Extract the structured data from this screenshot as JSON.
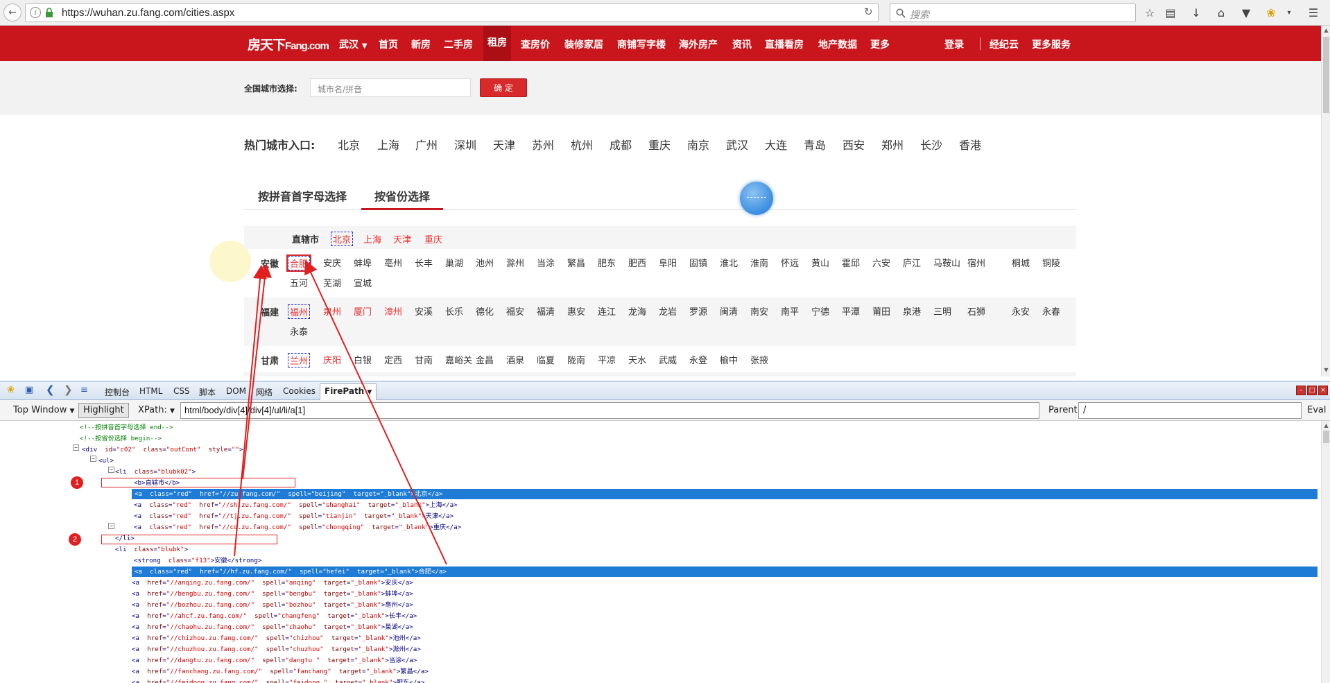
{
  "browser": {
    "url": "https://wuhan.zu.fang.com/cities.aspx",
    "search_placeholder": "搜索"
  },
  "site": {
    "logo_main": "房天下",
    "logo_sub": "Fang.com",
    "city_selector": "武汉",
    "nav": [
      "首页",
      "新房",
      "二手房",
      "租房",
      "查房价",
      "装修家居",
      "商铺写字楼",
      "海外房产",
      "资讯",
      "直播看房",
      "地产数据",
      "更多"
    ],
    "active_nav": "租房",
    "login": "登录",
    "agent": "经纪云",
    "more_services": "更多服务"
  },
  "city_search": {
    "label": "全国城市选择:",
    "placeholder": "城市名/拼音",
    "button": "确 定"
  },
  "hot": {
    "label": "热门城市入口:",
    "cities": [
      "北京",
      "上海",
      "广州",
      "深圳",
      "天津",
      "苏州",
      "杭州",
      "成都",
      "重庆",
      "南京",
      "武汉",
      "大连",
      "青岛",
      "西安",
      "郑州",
      "长沙",
      "香港"
    ]
  },
  "tabs": [
    "按拼音首字母选择",
    "按省份选择"
  ],
  "provinces": {
    "direct": {
      "name": "直辖市",
      "cities": [
        "北京",
        "上海",
        "天津",
        "重庆"
      ]
    },
    "anhui": {
      "name": "安徽",
      "line1": [
        "合肥",
        "安庆",
        "蚌埠",
        "亳州",
        "长丰",
        "巢湖",
        "池州",
        "滁州",
        "当涂",
        "繁昌",
        "肥东",
        "肥西",
        "阜阳",
        "固镇",
        "淮北",
        "淮南",
        "怀远",
        "黄山",
        "霍邱",
        "六安",
        "庐江",
        "马鞍山",
        "宿州",
        "桐城",
        "铜陵"
      ],
      "line2": [
        "五河",
        "芜湖",
        "宣城"
      ]
    },
    "fujian": {
      "name": "福建",
      "line1": [
        "福州",
        "泉州",
        "厦门",
        "漳州",
        "安溪",
        "长乐",
        "德化",
        "福安",
        "福清",
        "惠安",
        "连江",
        "龙海",
        "龙岩",
        "罗源",
        "闽清",
        "南安",
        "南平",
        "宁德",
        "平潭",
        "莆田",
        "泉港",
        "三明",
        "石狮",
        "永安",
        "永春"
      ],
      "line2": [
        "永泰"
      ]
    },
    "gansu": {
      "name": "甘肃",
      "cities": [
        "兰州",
        "庆阳",
        "白银",
        "定西",
        "甘南",
        "嘉峪关",
        "金昌",
        "酒泉",
        "临夏",
        "陇南",
        "平凉",
        "天水",
        "武威",
        "永登",
        "榆中",
        "张掖"
      ]
    }
  },
  "devtools": {
    "tabs": [
      "控制台",
      "HTML",
      "CSS",
      "脚本",
      "DOM",
      "网络",
      "Cookies",
      "FirePath"
    ],
    "active_tab": "FirePath",
    "window_selector": "Top Window",
    "highlight": "Highlight",
    "xpath_label": "XPath:",
    "xpath_value": "html/body/div[4]/div[4]/ul/li/a[1]",
    "parent_label": "Parent:",
    "parent_value": "/",
    "eval": "Eval",
    "markers": [
      "1",
      "2"
    ],
    "lines": [
      "<!--按拼音首字母选择 end-->",
      "<!--按省份选择 begin-->",
      "<div  id=\"c02\"  class=\"outCont\"  style=\"\">",
      "<ul>",
      "<li  class=\"blubk02\">",
      "<b>直辖市</b>",
      "<a  class=\"red\"  href=\"//zu.fang.com/\"  spell=\"beijing\"  target=\"_blank\">北京</a>",
      "<a  class=\"red\"  href=\"//sh.zu.fang.com/\"  spell=\"shanghai\"  target=\"_blank\">上海</a>",
      "<a  class=\"red\"  href=\"//tj.zu.fang.com/\"  spell=\"tianjin\"  target=\"_blank\">天津</a>",
      "<a  class=\"red\"  href=\"//cq.zu.fang.com/\"  spell=\"chongqing\"  target=\"_blank\">重庆</a>",
      "</li>",
      "<li  class=\"blubk\">",
      "<strong  class=\"f13\">安徽</strong>",
      "<a  class=\"red\"  href=\"//hf.zu.fang.com/\"  spell=\"hefei\"  target=\"_blank\">合肥</a>",
      "<a  href=\"//anqing.zu.fang.com/\"  spell=\"anqing\"  target=\"_blank\">安庆</a>",
      "<a  href=\"//bengbu.zu.fang.com/\"  spell=\"bengbu\"  target=\"_blank\">蚌埠</a>",
      "<a  href=\"//bozhou.zu.fang.com/\"  spell=\"bozhou\"  target=\"_blank\">亳州</a>",
      "<a  href=\"//ahcf.zu.fang.com/\"  spell=\"changfeng\"  target=\"_blank\">长丰</a>",
      "<a  href=\"//chaohu.zu.fang.com/\"  spell=\"chaohu\"  target=\"_blank\">巢湖</a>",
      "<a  href=\"//chizhou.zu.fang.com/\"  spell=\"chizhou\"  target=\"_blank\">池州</a>",
      "<a  href=\"//chuzhou.zu.fang.com/\"  spell=\"chuzhou\"  target=\"_blank\">滁州</a>",
      "<a  href=\"//dangtu.zu.fang.com/\"  spell=\"dangtu \"  target=\"_blank\">当涂</a>",
      "<a  href=\"//fanchang.zu.fang.com/\"  spell=\"fanchang\"  target=\"_blank\">繁昌</a>",
      "<a  href=\"//feidong.zu.fang.com/\"  spell=\"feidong \"  target=\"_blank\">肥东</a>"
    ]
  }
}
